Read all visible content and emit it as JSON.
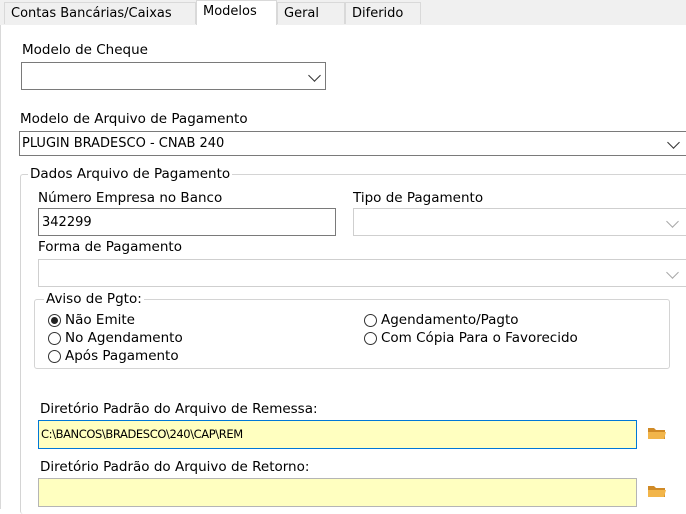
{
  "tabs": [
    {
      "label": "Contas Bancárias/Caixas"
    },
    {
      "label": "Modelos"
    },
    {
      "label": "Geral"
    },
    {
      "label": "Diferido"
    }
  ],
  "modelo_cheque": {
    "label": "Modelo de Cheque",
    "value": ""
  },
  "modelo_arquivo": {
    "label": "Modelo de Arquivo de Pagamento",
    "value": "PLUGIN BRADESCO - CNAB 240"
  },
  "dados": {
    "title": "Dados Arquivo de Pagamento",
    "numero_empresa_label": "Número Empresa no Banco",
    "numero_empresa_value": "342299",
    "tipo_pagamento_label": "Tipo de Pagamento",
    "tipo_pagamento_value": "",
    "forma_pagamento_label": "Forma de Pagamento",
    "forma_pagamento_value": ""
  },
  "aviso": {
    "title": "Aviso de Pgto:",
    "options": [
      {
        "label": "Não Emite",
        "checked": true
      },
      {
        "label": "No Agendamento",
        "checked": false
      },
      {
        "label": "Após Pagamento",
        "checked": false
      },
      {
        "label": "Agendamento/Pagto",
        "checked": false
      },
      {
        "label": "Com Cópia Para o Favorecido",
        "checked": false
      }
    ]
  },
  "remessa": {
    "label": "Diretório Padrão do Arquivo de Remessa:",
    "value": "C:\\BANCOS\\BRADESCO\\240\\CAP\\REM"
  },
  "retorno": {
    "label": "Diretório Padrão do Arquivo de Retorno:",
    "value": ""
  },
  "colors": {
    "field_yellow": "#ffffc0",
    "focus_border": "#0078d7",
    "folder": "#e8a33d"
  }
}
